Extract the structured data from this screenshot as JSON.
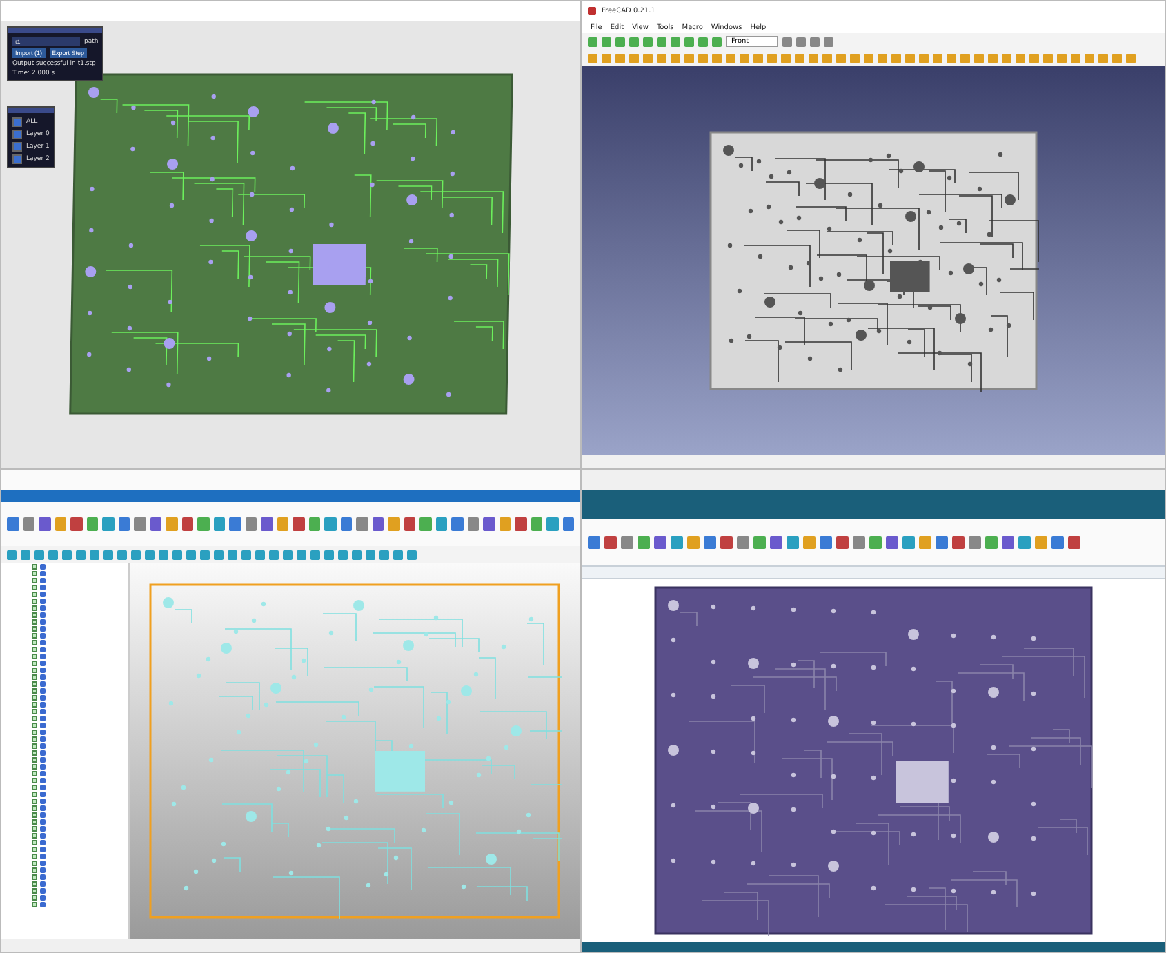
{
  "viewer_3d": {
    "output_panel": {
      "field_value": "t1",
      "field_label": "path",
      "buttons": [
        "Import (1)",
        "Export Step"
      ],
      "message": "Output successful in t1.stp",
      "time": "Time: 2.000 s"
    },
    "layers": [
      {
        "label": "ALL",
        "checked": true
      },
      {
        "label": "Layer 0",
        "checked": true
      },
      {
        "label": "Layer 1",
        "checked": true
      },
      {
        "label": "Layer 2",
        "checked": true
      }
    ]
  },
  "freecad": {
    "title": "FreeCAD 0.21.1",
    "menu": [
      "File",
      "Edit",
      "View",
      "Tools",
      "Macro",
      "Windows",
      "Help"
    ],
    "view_select": "Front"
  },
  "cad_tree": {
    "items": [
      {
        "checked": true
      },
      {
        "checked": true
      },
      {
        "checked": true
      },
      {
        "checked": true
      },
      {
        "checked": true
      },
      {
        "checked": true
      },
      {
        "checked": true
      },
      {
        "checked": true
      },
      {
        "checked": true
      },
      {
        "checked": true
      },
      {
        "checked": true
      },
      {
        "checked": true
      },
      {
        "checked": true
      },
      {
        "checked": true
      },
      {
        "checked": true
      },
      {
        "checked": true
      },
      {
        "checked": true
      },
      {
        "checked": true
      },
      {
        "checked": true
      },
      {
        "checked": true
      },
      {
        "checked": true
      },
      {
        "checked": true
      },
      {
        "checked": true
      },
      {
        "checked": true
      },
      {
        "checked": true
      },
      {
        "checked": true
      },
      {
        "checked": true
      },
      {
        "checked": true
      },
      {
        "checked": true
      },
      {
        "checked": true
      },
      {
        "checked": true
      },
      {
        "checked": true
      },
      {
        "checked": true
      },
      {
        "checked": true
      },
      {
        "checked": true
      },
      {
        "checked": true
      },
      {
        "checked": true
      },
      {
        "checked": true
      },
      {
        "checked": true
      },
      {
        "checked": true
      },
      {
        "checked": true
      },
      {
        "checked": true
      },
      {
        "checked": true
      },
      {
        "checked": true
      },
      {
        "checked": true
      },
      {
        "checked": true
      },
      {
        "checked": true
      },
      {
        "checked": true
      },
      {
        "checked": true
      },
      {
        "checked": true
      }
    ]
  }
}
